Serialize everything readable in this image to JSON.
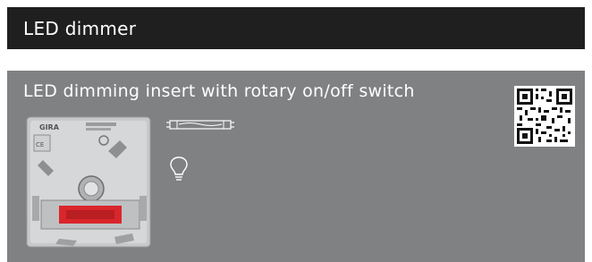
{
  "header": {
    "title": "LED dimmer"
  },
  "product": {
    "title": "LED dimming insert with rotary on/off switch",
    "brand": "GIRA",
    "icons": [
      "led-tube-icon",
      "light-bulb-icon",
      "qr-code-icon"
    ]
  },
  "colors": {
    "header_bg": "#1f1f1f",
    "panel_bg": "#808183",
    "text": "#ffffff",
    "switch_red": "#d9262b"
  }
}
